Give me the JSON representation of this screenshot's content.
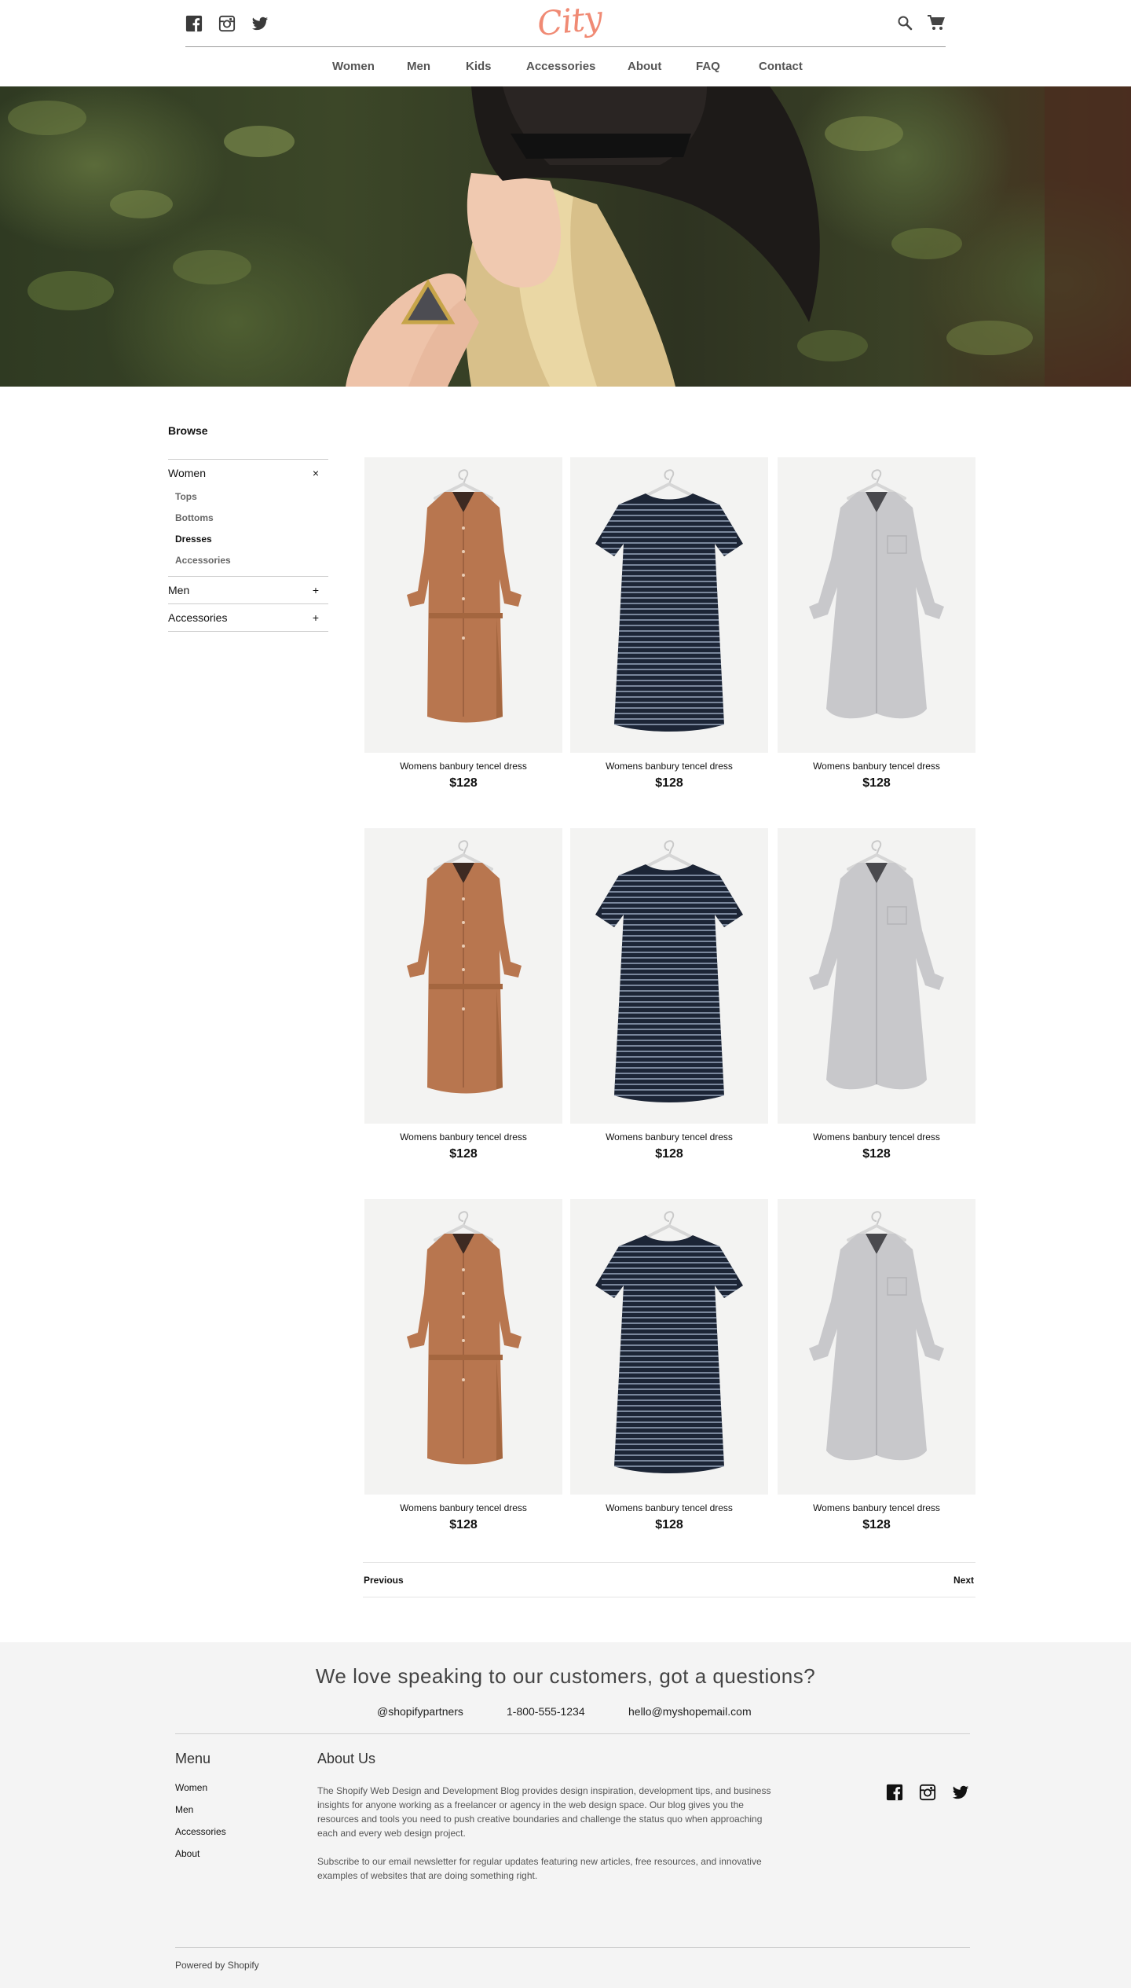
{
  "brand": {
    "logo_text": "City",
    "logo_color": "#f08a74"
  },
  "header": {
    "social_icons": [
      "facebook-icon",
      "instagram-icon",
      "twitter-icon"
    ],
    "utility_icons": [
      "search-icon",
      "cart-icon"
    ]
  },
  "nav": {
    "items": [
      "Women",
      "Men",
      "Kids",
      "Accessories",
      "About",
      "FAQ",
      "Contact"
    ]
  },
  "sidebar": {
    "title": "Browse",
    "categories": [
      {
        "label": "Women",
        "toggle": "×",
        "expanded": true,
        "subcategories": [
          {
            "label": "Tops",
            "active": false
          },
          {
            "label": "Bottoms",
            "active": false
          },
          {
            "label": "Dresses",
            "active": true
          },
          {
            "label": "Accessories",
            "active": false
          }
        ]
      },
      {
        "label": "Men",
        "toggle": "+",
        "expanded": false
      },
      {
        "label": "Accessories",
        "toggle": "+",
        "expanded": false
      }
    ]
  },
  "products": [
    {
      "name": "Womens banbury tencel dress",
      "price": "$128",
      "image": "rust-shirt-dress"
    },
    {
      "name": "Womens banbury tencel dress",
      "price": "$128",
      "image": "navy-striped-dress"
    },
    {
      "name": "Womens banbury tencel dress",
      "price": "$128",
      "image": "grey-shirt-dress"
    },
    {
      "name": "Womens banbury tencel dress",
      "price": "$128",
      "image": "rust-shirt-dress"
    },
    {
      "name": "Womens banbury tencel dress",
      "price": "$128",
      "image": "navy-striped-dress"
    },
    {
      "name": "Womens banbury tencel dress",
      "price": "$128",
      "image": "grey-shirt-dress"
    },
    {
      "name": "Womens banbury tencel dress",
      "price": "$128",
      "image": "rust-shirt-dress"
    },
    {
      "name": "Womens banbury tencel dress",
      "price": "$128",
      "image": "navy-striped-dress"
    },
    {
      "name": "Womens banbury tencel dress",
      "price": "$128",
      "image": "grey-shirt-dress"
    }
  ],
  "pagination": {
    "previous": "Previous",
    "next": "Next"
  },
  "footer": {
    "tagline": "We love speaking to our customers, got a questions?",
    "contacts": [
      "@shopifypartners",
      "1-800-555-1234",
      "hello@myshopemail.com"
    ],
    "menu_title": "Menu",
    "menu_items": [
      "Women",
      "Men",
      "Accessories",
      "About"
    ],
    "about_title": "About Us",
    "about_text": "The Shopify Web Design and Development Blog provides design inspiration, development tips, and business insights for anyone working as a freelancer or agency in the web design space. Our blog gives you the resources and tools you need to push creative boundaries and challenge the status quo when approaching each and every web design project.",
    "about_text_2": "Subscribe to our email newsletter for regular updates featuring new articles, free resources, and innovative examples of websites that are doing something right.",
    "social_icons": [
      "facebook-icon",
      "instagram-icon",
      "twitter-icon"
    ],
    "powered_by": "Powered by Shopify"
  }
}
